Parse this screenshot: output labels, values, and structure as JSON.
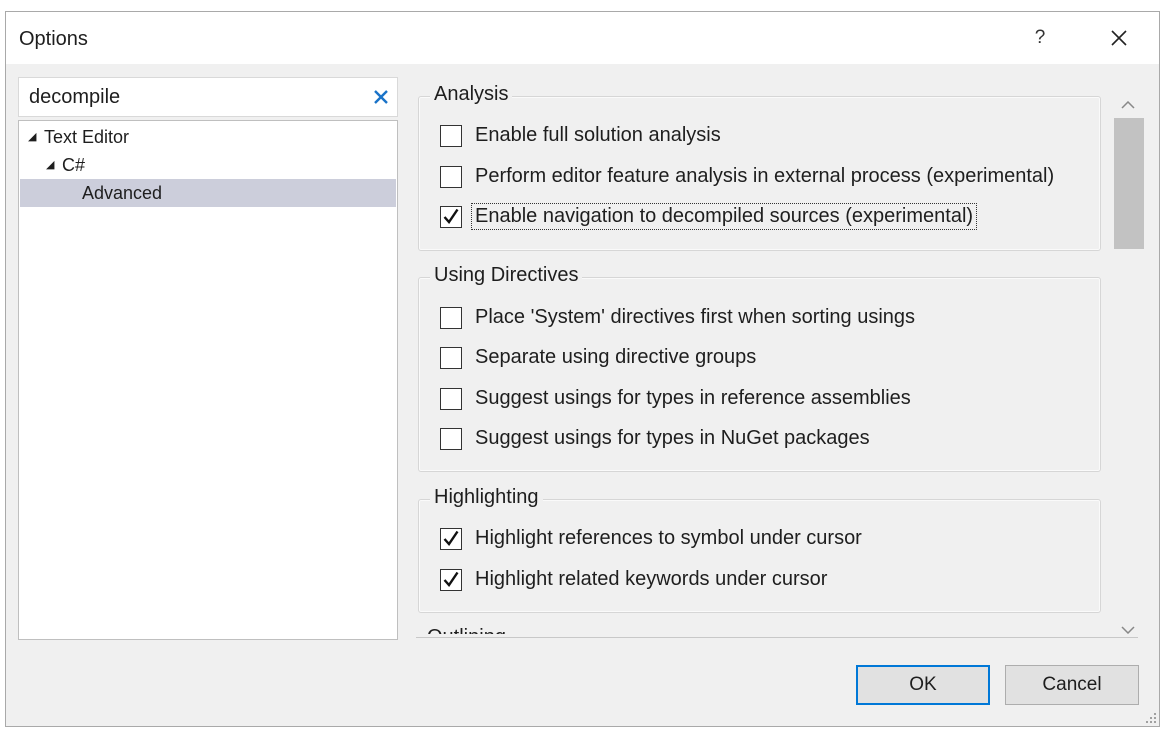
{
  "window": {
    "title": "Options",
    "help_label": "?"
  },
  "search": {
    "value": "decompile",
    "placeholder": ""
  },
  "tree": [
    {
      "label": "Text Editor",
      "arrow": "◢"
    },
    {
      "label": "C#",
      "arrow": "◢"
    },
    {
      "label": "Advanced",
      "arrow": ""
    }
  ],
  "groups": {
    "analysis": {
      "title": "Analysis",
      "options": [
        {
          "label": "Enable full solution analysis",
          "checked": false
        },
        {
          "label": "Perform editor feature analysis in external process (experimental)",
          "checked": false
        },
        {
          "label": "Enable navigation to decompiled sources (experimental)",
          "checked": true
        }
      ]
    },
    "using_directives": {
      "title": "Using Directives",
      "options": [
        {
          "label": "Place 'System' directives first when sorting usings",
          "checked": false
        },
        {
          "label": "Separate using directive groups",
          "checked": false
        },
        {
          "label": "Suggest usings for types in reference assemblies",
          "checked": false
        },
        {
          "label": "Suggest usings for types in NuGet packages",
          "checked": false
        }
      ]
    },
    "highlighting": {
      "title": "Highlighting",
      "options": [
        {
          "label": "Highlight references to symbol under cursor",
          "checked": true
        },
        {
          "label": "Highlight related keywords under cursor",
          "checked": true
        }
      ]
    },
    "partial_next": {
      "title": "Outlining"
    }
  },
  "buttons": {
    "ok": "OK",
    "cancel": "Cancel"
  },
  "icons": {
    "help": "help-icon",
    "close": "close-icon",
    "clear": "clear-search-icon",
    "expand": "expanded-arrow-icon",
    "check": "checkmark-icon",
    "scroll_up": "chevron-up-icon",
    "scroll_down": "chevron-down-icon",
    "grip": "resize-grip-icon"
  },
  "colors": {
    "dialog_bg": "#f0f0f0",
    "title_bg": "#ffffff",
    "selection": "#cccedb",
    "accent": "#0078d7",
    "clear_icon": "#1a73c8",
    "scroll_thumb": "#c2c2c2"
  }
}
